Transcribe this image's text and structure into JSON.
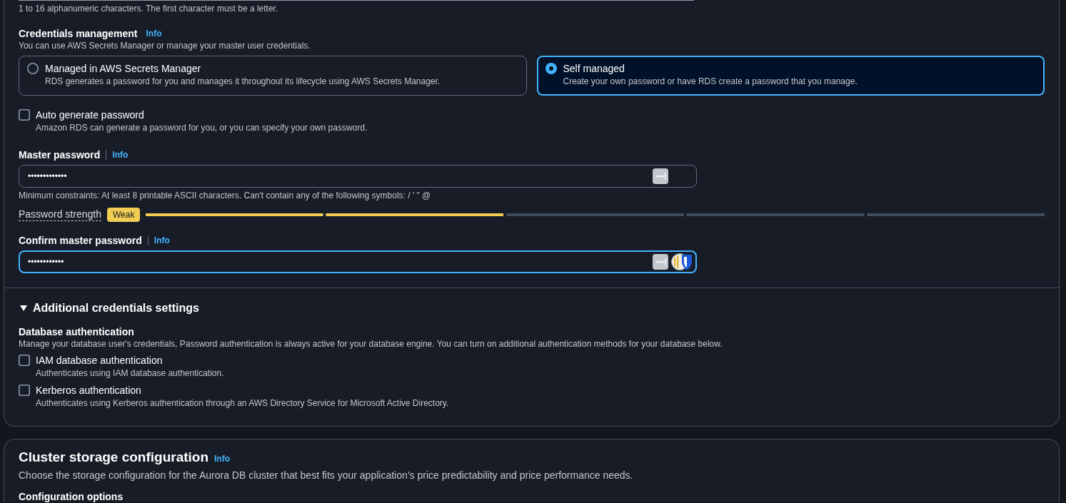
{
  "previous_field_hint": "1 to 16 alphanumeric characters. The first character must be a letter.",
  "credentials_management": {
    "label": "Credentials management",
    "info": "Info",
    "description": "You can use AWS Secrets Manager or manage your master user credentials.",
    "options": [
      {
        "title": "Managed in AWS Secrets Manager",
        "description": "RDS generates a password for you and manages it throughout its lifecycle using AWS Secrets Manager.",
        "selected": false
      },
      {
        "title": "Self managed",
        "description": "Create your own password or have RDS create a password that you manage.",
        "selected": true
      }
    ]
  },
  "auto_generate_password": {
    "label": "Auto generate password",
    "description": "Amazon RDS can generate a password for you, or you can specify your own password.",
    "checked": false
  },
  "master_password": {
    "label": "Master password",
    "info": "Info",
    "value": "•••••••••••••",
    "focused": false,
    "constraint": "Minimum constraints: At least 8 printable ASCII characters. Can't contain any of the following symbols: / ' \" @"
  },
  "password_strength": {
    "label": "Password strength",
    "rating": "Weak",
    "level": 0.4
  },
  "confirm_master_password": {
    "label": "Confirm master password",
    "info": "Info",
    "value": "••••••••••••",
    "focused": true
  },
  "additional_credentials_settings": {
    "title": "Additional credentials settings",
    "expanded": true,
    "database_authentication": {
      "label": "Database authentication",
      "description": "Manage your database user's credentials, Password authentication is always active for your database engine. You can turn on additional authentication methods for your database below.",
      "options": [
        {
          "label": "IAM database authentication",
          "description": "Authenticates using IAM database authentication.",
          "checked": false
        },
        {
          "label": "Kerberos authentication",
          "description": "Authenticates using Kerberos authentication through an AWS Directory Service for Microsoft Active Directory.",
          "checked": false
        }
      ]
    }
  },
  "cluster_storage_configuration": {
    "title": "Cluster storage configuration",
    "info": "Info",
    "description": "Choose the storage configuration for the Aurora DB cluster that best fits your application’s price predictability and price performance needs.",
    "configuration_label": "Configuration options"
  }
}
